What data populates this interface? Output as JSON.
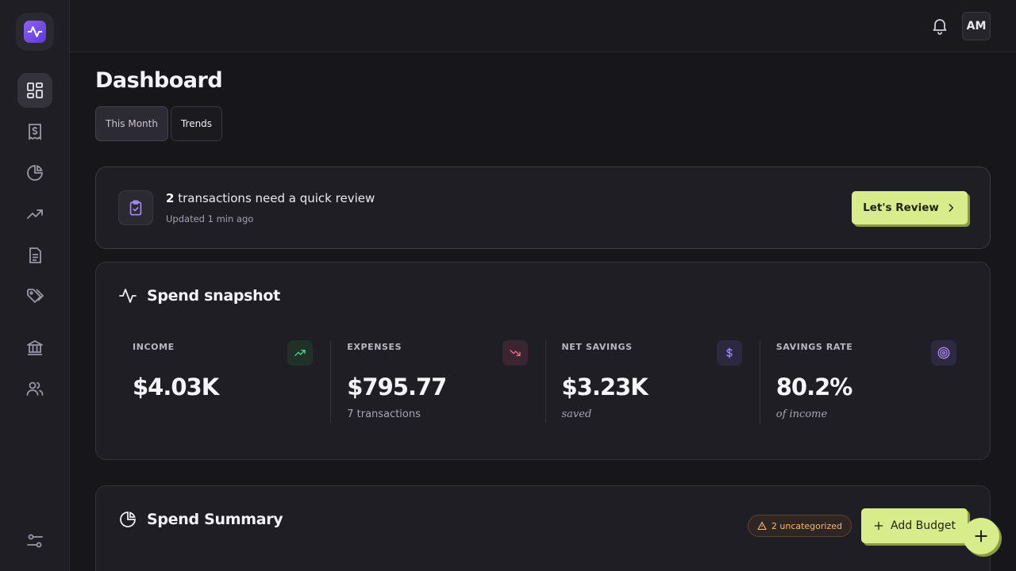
{
  "header": {
    "avatar_initials": "AM",
    "notifications_icon": "bell-icon"
  },
  "sidebar": {
    "logo_icon": "pulse-icon",
    "items": [
      {
        "name": "dashboard",
        "icon": "grid-icon",
        "active": true
      },
      {
        "name": "transactions",
        "icon": "receipt-dollar-icon",
        "active": false
      },
      {
        "name": "budgets",
        "icon": "pie-chart-icon",
        "active": false
      },
      {
        "name": "trends",
        "icon": "trending-up-icon",
        "active": false
      },
      {
        "name": "reports",
        "icon": "document-icon",
        "active": false
      },
      {
        "name": "categories",
        "icon": "tags-icon",
        "active": false
      },
      {
        "name": "accounts",
        "icon": "bank-icon",
        "active": false
      },
      {
        "name": "members",
        "icon": "users-icon",
        "active": false
      },
      {
        "name": "settings",
        "icon": "sliders-icon",
        "active": false
      }
    ]
  },
  "page": {
    "title": "Dashboard",
    "tabs": [
      {
        "label": "This Month",
        "active": true
      },
      {
        "label": "Trends",
        "active": false
      }
    ]
  },
  "review": {
    "count": "2",
    "title_rest": " transactions need a quick review",
    "subtitle": "Updated 1 min ago",
    "button_label": "Let's Review"
  },
  "snapshot": {
    "title": "Spend snapshot",
    "metrics": [
      {
        "label": "INCOME",
        "value": "$4.03K",
        "sub": "",
        "icon": "trend-up-icon",
        "icon_color": "#4fd68a"
      },
      {
        "label": "EXPENSES",
        "value": "$795.77",
        "sub": "7 transactions",
        "icon": "trend-down-icon",
        "icon_color": "#f06b8a"
      },
      {
        "label": "NET SAVINGS",
        "value": "$3.23K",
        "sub": "saved",
        "icon": "dollar-icon",
        "icon_color": "#9c84f5"
      },
      {
        "label": "SAVINGS RATE",
        "value": "80.2%",
        "sub": "of income",
        "icon": "target-icon",
        "icon_color": "#a98af5"
      }
    ]
  },
  "summary": {
    "title": "Spend Summary",
    "badge_label": "2 uncategorized",
    "add_button_label": "Add Budget"
  },
  "colors": {
    "accent": "#d9ec8c",
    "brand": "#7b4df0",
    "background": "#17161b"
  }
}
